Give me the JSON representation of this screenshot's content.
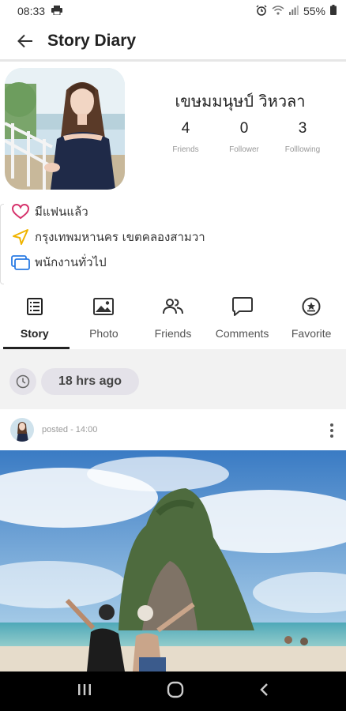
{
  "status_bar": {
    "time": "08:33",
    "battery": "55%",
    "icons": [
      "print-icon",
      "alarm-icon",
      "wifi-icon",
      "signal-icon",
      "battery-icon"
    ]
  },
  "app_bar": {
    "title": "Story Diary",
    "back_icon": "arrow-left-icon"
  },
  "profile": {
    "name": "เขษมมนุษป์ วิหวลา",
    "stats": [
      {
        "value": "4",
        "label": "Friends"
      },
      {
        "value": "0",
        "label": "Follower"
      },
      {
        "value": "3",
        "label": "Folllowing"
      }
    ]
  },
  "info": [
    {
      "icon": "heart-icon",
      "color": "#d6336c",
      "text": "มีแฟนแล้ว"
    },
    {
      "icon": "navigation-icon",
      "color": "#f0b400",
      "text": "กรุงเทพมหานคร เขตคลองสามวา"
    },
    {
      "icon": "folder-icon",
      "color": "#2a7be4",
      "text": "พนักงานทั่วไป"
    }
  ],
  "tabs": [
    {
      "label": "Story",
      "icon": "list-icon",
      "active": true
    },
    {
      "label": "Photo",
      "icon": "image-icon",
      "active": false
    },
    {
      "label": "Friends",
      "icon": "people-icon",
      "active": false
    },
    {
      "label": "Comments",
      "icon": "comment-icon",
      "active": false
    },
    {
      "label": "Favorite",
      "icon": "favorite-icon",
      "active": false
    }
  ],
  "feed": {
    "time_chip": "18 hrs ago",
    "post": {
      "meta": "posted - 14:00"
    }
  },
  "colors": {
    "chip_bg": "#e4e2e9",
    "feed_bg": "#f2f2f2",
    "nav_bg": "#000000"
  }
}
